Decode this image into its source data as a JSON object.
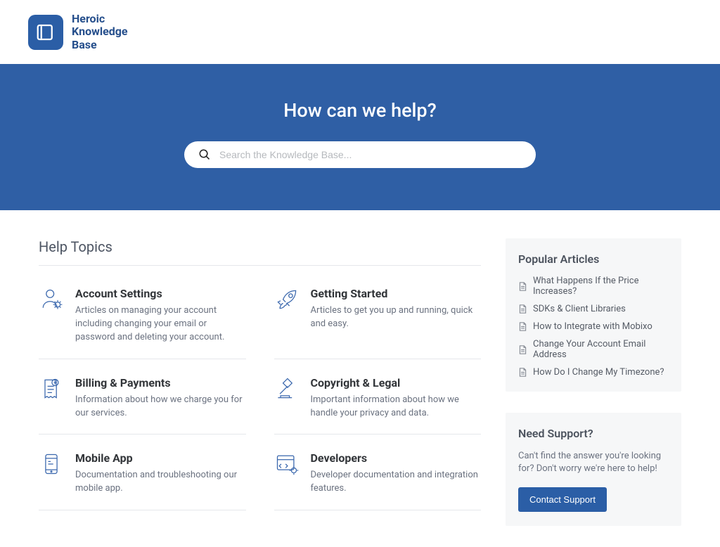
{
  "brand": {
    "line1": "Heroic",
    "line2": "Knowledge",
    "line3": "Base"
  },
  "hero": {
    "title": "How can we help?",
    "search_placeholder": "Search the Knowledge Base..."
  },
  "help_topics": {
    "heading": "Help Topics",
    "items": [
      {
        "title": "Account Settings",
        "desc": "Articles on managing your account including changing your email or password and deleting your account."
      },
      {
        "title": "Getting Started",
        "desc": "Articles to get you up and running, quick and easy."
      },
      {
        "title": "Billing & Payments",
        "desc": "Information about how we charge you for our services."
      },
      {
        "title": "Copyright & Legal",
        "desc": "Important information about how we handle your privacy and data."
      },
      {
        "title": "Mobile App",
        "desc": "Documentation and troubleshooting our mobile app."
      },
      {
        "title": "Developers",
        "desc": "Developer documentation and integration features."
      }
    ]
  },
  "popular": {
    "heading": "Popular Articles",
    "items": [
      "What Happens If the Price Increases?",
      "SDKs & Client Libraries",
      "How to Integrate with Mobixo",
      "Change Your Account Email Address",
      "How Do I Change My Timezone?"
    ]
  },
  "support": {
    "heading": "Need Support?",
    "text": "Can't find the answer you're looking for? Don't worry we're here to help!",
    "button": "Contact Support"
  }
}
